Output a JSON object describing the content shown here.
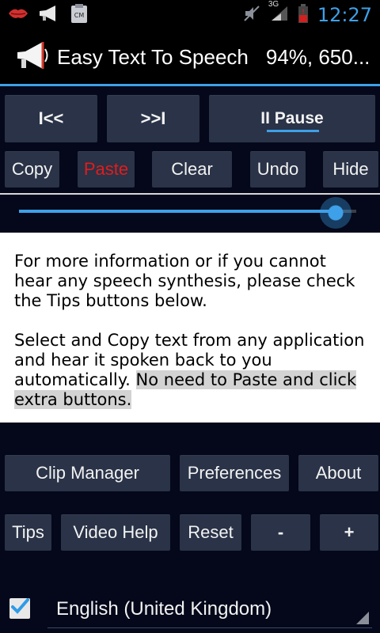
{
  "status_bar": {
    "network": "3G",
    "time": "12:27"
  },
  "header": {
    "title": "Easy Text To Speech",
    "status": "94%, 650..."
  },
  "transport": {
    "prev_label": "I<<",
    "next_label": ">>I",
    "pause_label": "II Pause"
  },
  "edit": {
    "copy": "Copy",
    "paste": "Paste",
    "clear": "Clear",
    "undo": "Undo",
    "hide": "Hide"
  },
  "seek": {
    "progress": 0.94
  },
  "text": {
    "para1": "For more information or if you cannot hear any speech synthesis, please check the Tips buttons below.",
    "para2_plain": "Select and Copy text from any application and hear it spoken back to you automatically. ",
    "para2_selected": "No need to Paste and click extra buttons."
  },
  "actions": {
    "clip_manager": "Clip Manager",
    "preferences": "Preferences",
    "about": "About",
    "tips": "Tips",
    "video_help": "Video Help",
    "reset": "Reset",
    "minus": "-",
    "plus": "+"
  },
  "language": {
    "checked": true,
    "selected": "English (United Kingdom)"
  },
  "colors": {
    "accent": "#3ea0e8",
    "paste_label": "#e11c1c",
    "button_bg": "#2a3347",
    "background": "#04081a"
  }
}
